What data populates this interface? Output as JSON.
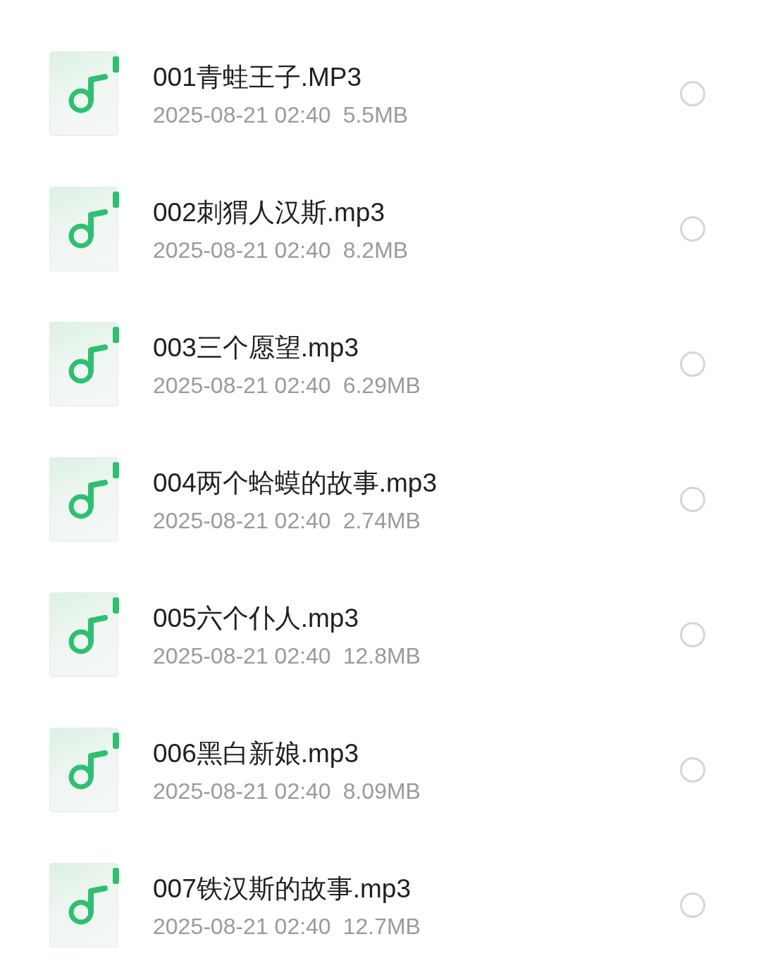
{
  "files": [
    {
      "name": "001青蛙王子.MP3",
      "date": "2025-08-21 02:40",
      "size": "5.5MB",
      "selected": false
    },
    {
      "name": "002刺猬人汉斯.mp3",
      "date": "2025-08-21 02:40",
      "size": "8.2MB",
      "selected": false
    },
    {
      "name": "003三个愿望.mp3",
      "date": "2025-08-21 02:40",
      "size": "6.29MB",
      "selected": false
    },
    {
      "name": "004两个蛤蟆的故事.mp3",
      "date": "2025-08-21 02:40",
      "size": "2.74MB",
      "selected": false
    },
    {
      "name": "005六个仆人.mp3",
      "date": "2025-08-21 02:40",
      "size": "12.8MB",
      "selected": false
    },
    {
      "name": "006黑白新娘.mp3",
      "date": "2025-08-21 02:40",
      "size": "8.09MB",
      "selected": false
    },
    {
      "name": "007铁汉斯的故事.mp3",
      "date": "2025-08-21 02:40",
      "size": "12.7MB",
      "selected": false
    }
  ]
}
